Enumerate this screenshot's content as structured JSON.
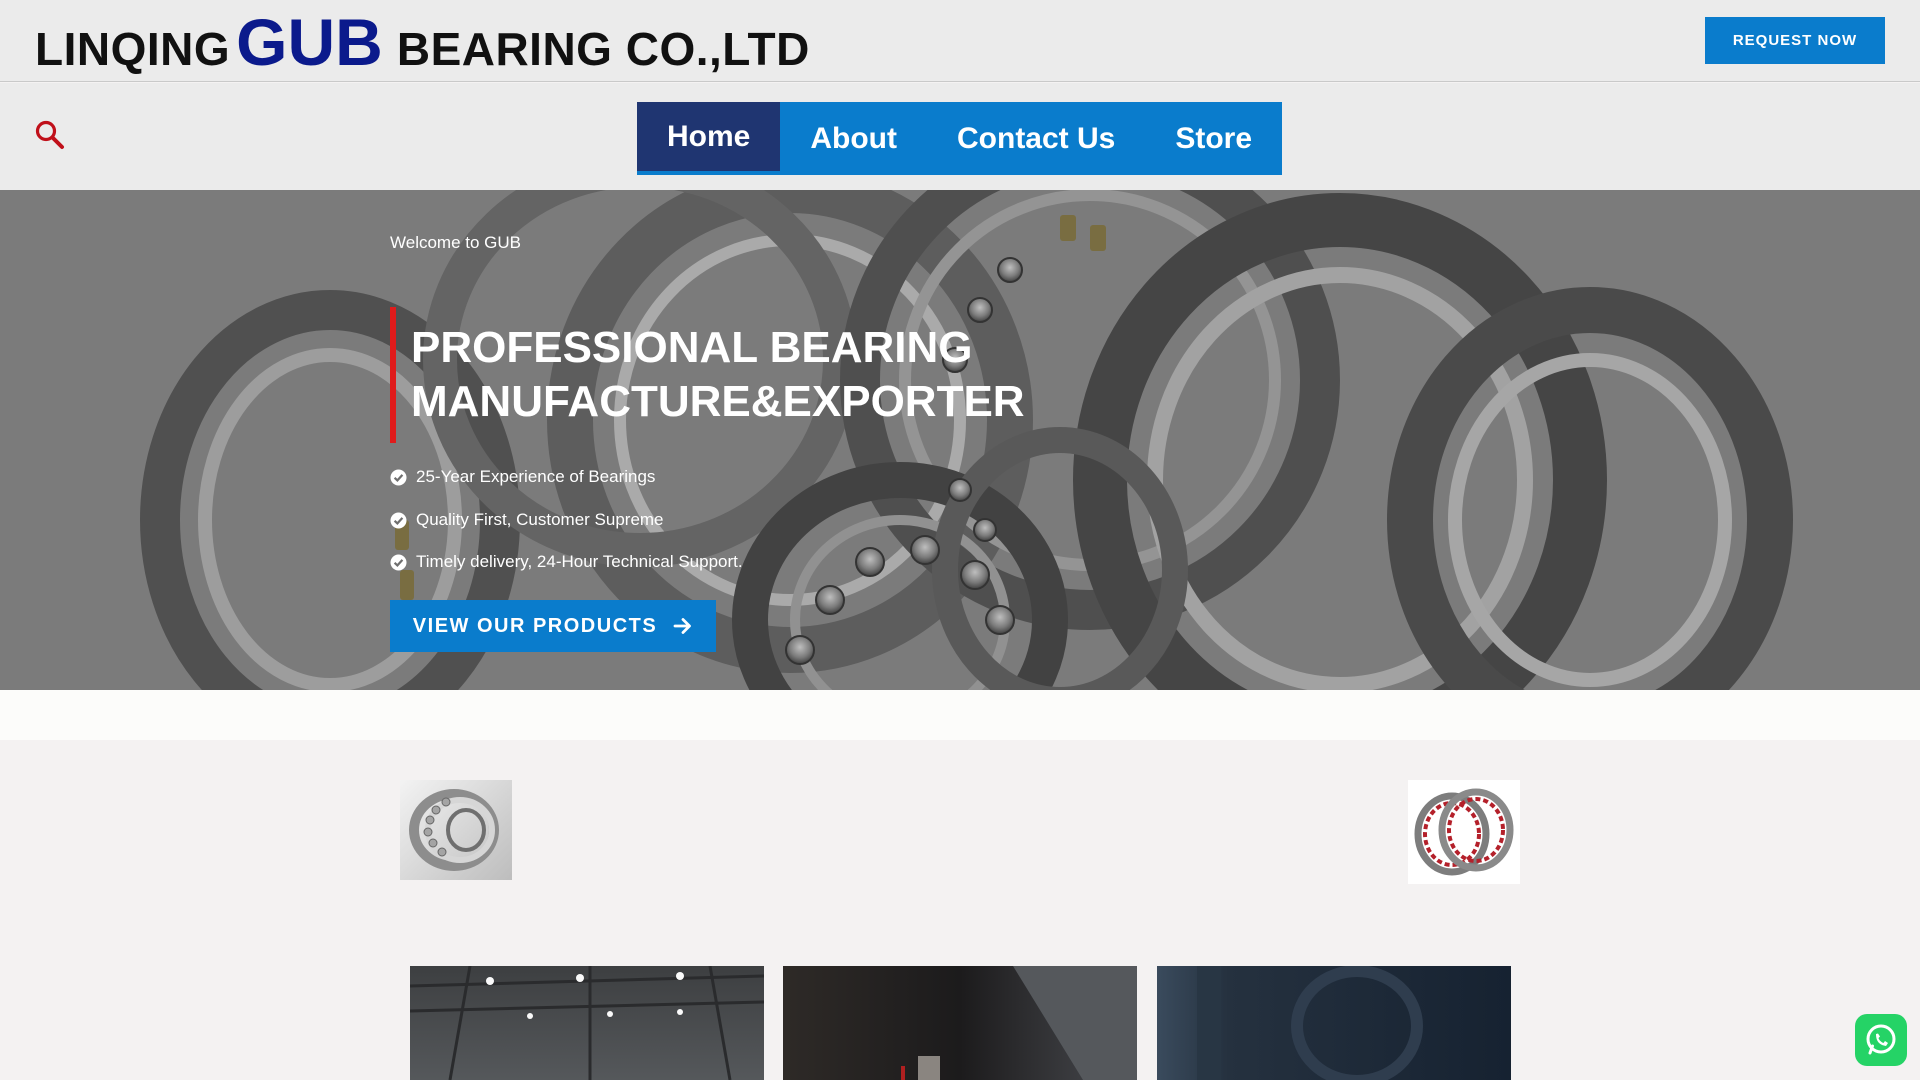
{
  "header": {
    "logo_part1": "LINQING",
    "logo_part2": "GUB",
    "logo_part3": "BEARING CO.,LTD",
    "request_button": "REQUEST NOW"
  },
  "nav": {
    "items": [
      {
        "label": "Home",
        "active": true
      },
      {
        "label": "About",
        "active": false
      },
      {
        "label": "Contact Us",
        "active": false
      },
      {
        "label": "Store",
        "active": false
      }
    ]
  },
  "hero": {
    "welcome": "Welcome to GUB",
    "headline_line1": "PROFESSIONAL BEARING",
    "headline_line2": "MANUFACTURE&EXPORTER",
    "features": [
      "25-Year Experience of Bearings",
      "Quality First, Customer Supreme",
      "Timely delivery, 24-Hour Technical Support."
    ],
    "cta": "VIEW OUR PRODUCTS"
  },
  "colors": {
    "brand_blue": "#0a7ccc",
    "nav_active": "#1f3571",
    "logo_accent": "#0b1a8c",
    "headline_bar": "#e01b1b",
    "search_icon": "#c0101a",
    "whatsapp": "#25d366"
  },
  "icons": {
    "search": "search-icon",
    "check": "check-circle-icon",
    "arrow": "arrow-right-icon",
    "whatsapp": "whatsapp-icon"
  }
}
